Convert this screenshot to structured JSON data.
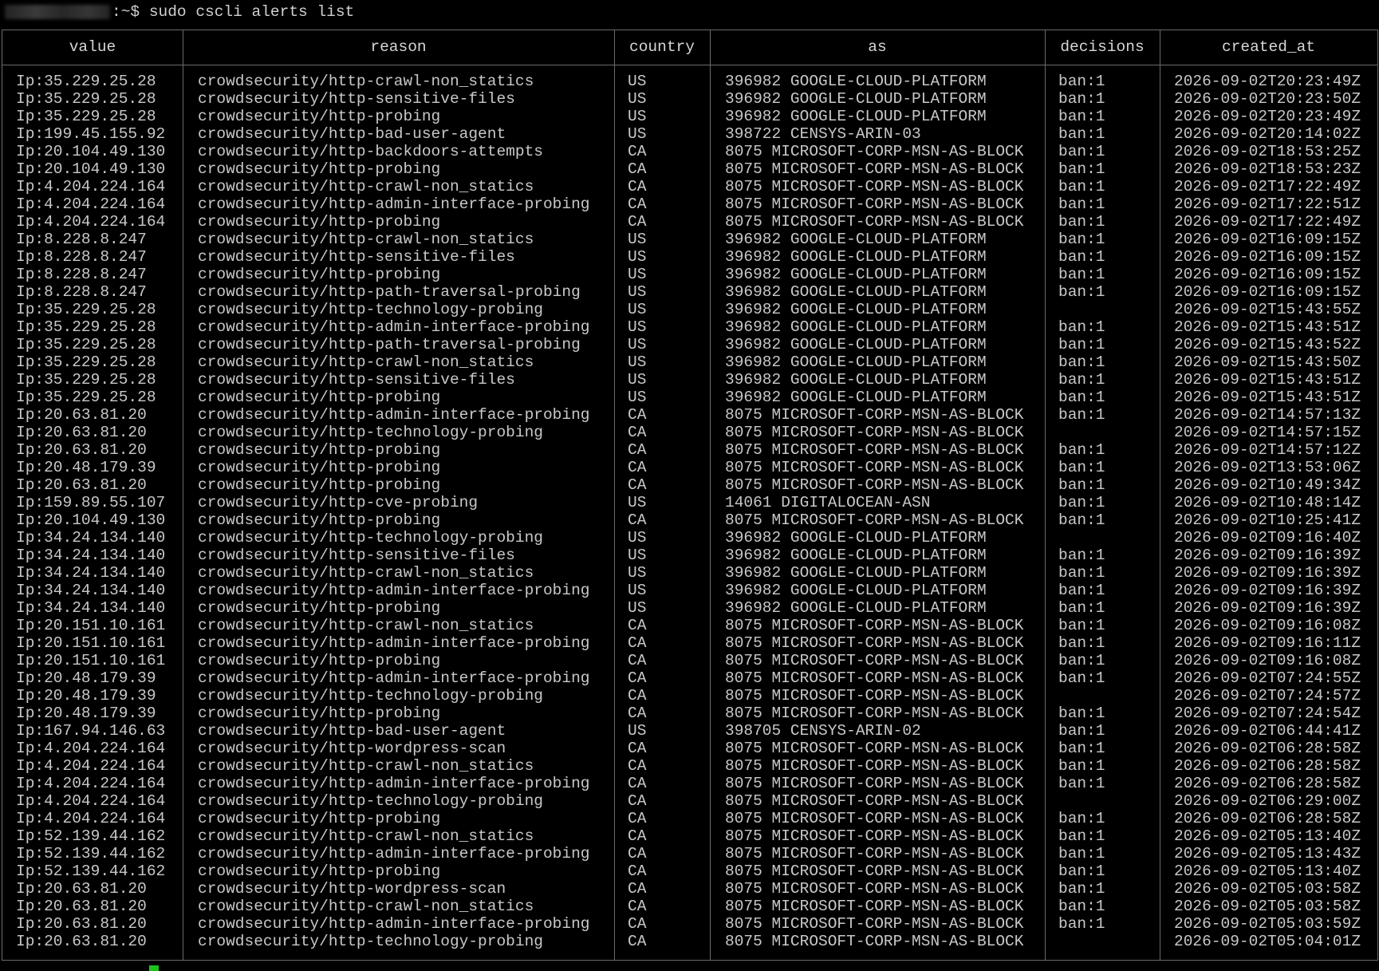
{
  "terminal": {
    "prompt_user": "",
    "prompt_suffix": ":~$ ",
    "command": "sudo cscli alerts list"
  },
  "table": {
    "headers": [
      "value",
      "reason",
      "country",
      "as",
      "decisions",
      "created_at"
    ],
    "rows": [
      [
        "Ip:35.229.25.28",
        "crowdsecurity/http-crawl-non_statics",
        "US",
        "396982 GOOGLE-CLOUD-PLATFORM",
        "ban:1",
        "2026-09-02T20:23:49Z"
      ],
      [
        "Ip:35.229.25.28",
        "crowdsecurity/http-sensitive-files",
        "US",
        "396982 GOOGLE-CLOUD-PLATFORM",
        "ban:1",
        "2026-09-02T20:23:50Z"
      ],
      [
        "Ip:35.229.25.28",
        "crowdsecurity/http-probing",
        "US",
        "396982 GOOGLE-CLOUD-PLATFORM",
        "ban:1",
        "2026-09-02T20:23:49Z"
      ],
      [
        "Ip:199.45.155.92",
        "crowdsecurity/http-bad-user-agent",
        "US",
        "398722 CENSYS-ARIN-03",
        "ban:1",
        "2026-09-02T20:14:02Z"
      ],
      [
        "Ip:20.104.49.130",
        "crowdsecurity/http-backdoors-attempts",
        "CA",
        "8075 MICROSOFT-CORP-MSN-AS-BLOCK",
        "ban:1",
        "2026-09-02T18:53:25Z"
      ],
      [
        "Ip:20.104.49.130",
        "crowdsecurity/http-probing",
        "CA",
        "8075 MICROSOFT-CORP-MSN-AS-BLOCK",
        "ban:1",
        "2026-09-02T18:53:23Z"
      ],
      [
        "Ip:4.204.224.164",
        "crowdsecurity/http-crawl-non_statics",
        "CA",
        "8075 MICROSOFT-CORP-MSN-AS-BLOCK",
        "ban:1",
        "2026-09-02T17:22:49Z"
      ],
      [
        "Ip:4.204.224.164",
        "crowdsecurity/http-admin-interface-probing",
        "CA",
        "8075 MICROSOFT-CORP-MSN-AS-BLOCK",
        "ban:1",
        "2026-09-02T17:22:51Z"
      ],
      [
        "Ip:4.204.224.164",
        "crowdsecurity/http-probing",
        "CA",
        "8075 MICROSOFT-CORP-MSN-AS-BLOCK",
        "ban:1",
        "2026-09-02T17:22:49Z"
      ],
      [
        "Ip:8.228.8.247",
        "crowdsecurity/http-crawl-non_statics",
        "US",
        "396982 GOOGLE-CLOUD-PLATFORM",
        "ban:1",
        "2026-09-02T16:09:15Z"
      ],
      [
        "Ip:8.228.8.247",
        "crowdsecurity/http-sensitive-files",
        "US",
        "396982 GOOGLE-CLOUD-PLATFORM",
        "ban:1",
        "2026-09-02T16:09:15Z"
      ],
      [
        "Ip:8.228.8.247",
        "crowdsecurity/http-probing",
        "US",
        "396982 GOOGLE-CLOUD-PLATFORM",
        "ban:1",
        "2026-09-02T16:09:15Z"
      ],
      [
        "Ip:8.228.8.247",
        "crowdsecurity/http-path-traversal-probing",
        "US",
        "396982 GOOGLE-CLOUD-PLATFORM",
        "ban:1",
        "2026-09-02T16:09:15Z"
      ],
      [
        "Ip:35.229.25.28",
        "crowdsecurity/http-technology-probing",
        "US",
        "396982 GOOGLE-CLOUD-PLATFORM",
        "",
        "2026-09-02T15:43:55Z"
      ],
      [
        "Ip:35.229.25.28",
        "crowdsecurity/http-admin-interface-probing",
        "US",
        "396982 GOOGLE-CLOUD-PLATFORM",
        "ban:1",
        "2026-09-02T15:43:51Z"
      ],
      [
        "Ip:35.229.25.28",
        "crowdsecurity/http-path-traversal-probing",
        "US",
        "396982 GOOGLE-CLOUD-PLATFORM",
        "ban:1",
        "2026-09-02T15:43:52Z"
      ],
      [
        "Ip:35.229.25.28",
        "crowdsecurity/http-crawl-non_statics",
        "US",
        "396982 GOOGLE-CLOUD-PLATFORM",
        "ban:1",
        "2026-09-02T15:43:50Z"
      ],
      [
        "Ip:35.229.25.28",
        "crowdsecurity/http-sensitive-files",
        "US",
        "396982 GOOGLE-CLOUD-PLATFORM",
        "ban:1",
        "2026-09-02T15:43:51Z"
      ],
      [
        "Ip:35.229.25.28",
        "crowdsecurity/http-probing",
        "US",
        "396982 GOOGLE-CLOUD-PLATFORM",
        "ban:1",
        "2026-09-02T15:43:51Z"
      ],
      [
        "Ip:20.63.81.20",
        "crowdsecurity/http-admin-interface-probing",
        "CA",
        "8075 MICROSOFT-CORP-MSN-AS-BLOCK",
        "ban:1",
        "2026-09-02T14:57:13Z"
      ],
      [
        "Ip:20.63.81.20",
        "crowdsecurity/http-technology-probing",
        "CA",
        "8075 MICROSOFT-CORP-MSN-AS-BLOCK",
        "",
        "2026-09-02T14:57:15Z"
      ],
      [
        "Ip:20.63.81.20",
        "crowdsecurity/http-probing",
        "CA",
        "8075 MICROSOFT-CORP-MSN-AS-BLOCK",
        "ban:1",
        "2026-09-02T14:57:12Z"
      ],
      [
        "Ip:20.48.179.39",
        "crowdsecurity/http-probing",
        "CA",
        "8075 MICROSOFT-CORP-MSN-AS-BLOCK",
        "ban:1",
        "2026-09-02T13:53:06Z"
      ],
      [
        "Ip:20.63.81.20",
        "crowdsecurity/http-probing",
        "CA",
        "8075 MICROSOFT-CORP-MSN-AS-BLOCK",
        "ban:1",
        "2026-09-02T10:49:34Z"
      ],
      [
        "Ip:159.89.55.107",
        "crowdsecurity/http-cve-probing",
        "US",
        "14061 DIGITALOCEAN-ASN",
        "ban:1",
        "2026-09-02T10:48:14Z"
      ],
      [
        "Ip:20.104.49.130",
        "crowdsecurity/http-probing",
        "CA",
        "8075 MICROSOFT-CORP-MSN-AS-BLOCK",
        "ban:1",
        "2026-09-02T10:25:41Z"
      ],
      [
        "Ip:34.24.134.140",
        "crowdsecurity/http-technology-probing",
        "US",
        "396982 GOOGLE-CLOUD-PLATFORM",
        "",
        "2026-09-02T09:16:40Z"
      ],
      [
        "Ip:34.24.134.140",
        "crowdsecurity/http-sensitive-files",
        "US",
        "396982 GOOGLE-CLOUD-PLATFORM",
        "ban:1",
        "2026-09-02T09:16:39Z"
      ],
      [
        "Ip:34.24.134.140",
        "crowdsecurity/http-crawl-non_statics",
        "US",
        "396982 GOOGLE-CLOUD-PLATFORM",
        "ban:1",
        "2026-09-02T09:16:39Z"
      ],
      [
        "Ip:34.24.134.140",
        "crowdsecurity/http-admin-interface-probing",
        "US",
        "396982 GOOGLE-CLOUD-PLATFORM",
        "ban:1",
        "2026-09-02T09:16:39Z"
      ],
      [
        "Ip:34.24.134.140",
        "crowdsecurity/http-probing",
        "US",
        "396982 GOOGLE-CLOUD-PLATFORM",
        "ban:1",
        "2026-09-02T09:16:39Z"
      ],
      [
        "Ip:20.151.10.161",
        "crowdsecurity/http-crawl-non_statics",
        "CA",
        "8075 MICROSOFT-CORP-MSN-AS-BLOCK",
        "ban:1",
        "2026-09-02T09:16:08Z"
      ],
      [
        "Ip:20.151.10.161",
        "crowdsecurity/http-admin-interface-probing",
        "CA",
        "8075 MICROSOFT-CORP-MSN-AS-BLOCK",
        "ban:1",
        "2026-09-02T09:16:11Z"
      ],
      [
        "Ip:20.151.10.161",
        "crowdsecurity/http-probing",
        "CA",
        "8075 MICROSOFT-CORP-MSN-AS-BLOCK",
        "ban:1",
        "2026-09-02T09:16:08Z"
      ],
      [
        "Ip:20.48.179.39",
        "crowdsecurity/http-admin-interface-probing",
        "CA",
        "8075 MICROSOFT-CORP-MSN-AS-BLOCK",
        "ban:1",
        "2026-09-02T07:24:55Z"
      ],
      [
        "Ip:20.48.179.39",
        "crowdsecurity/http-technology-probing",
        "CA",
        "8075 MICROSOFT-CORP-MSN-AS-BLOCK",
        "",
        "2026-09-02T07:24:57Z"
      ],
      [
        "Ip:20.48.179.39",
        "crowdsecurity/http-probing",
        "CA",
        "8075 MICROSOFT-CORP-MSN-AS-BLOCK",
        "ban:1",
        "2026-09-02T07:24:54Z"
      ],
      [
        "Ip:167.94.146.63",
        "crowdsecurity/http-bad-user-agent",
        "US",
        "398705 CENSYS-ARIN-02",
        "ban:1",
        "2026-09-02T06:44:41Z"
      ],
      [
        "Ip:4.204.224.164",
        "crowdsecurity/http-wordpress-scan",
        "CA",
        "8075 MICROSOFT-CORP-MSN-AS-BLOCK",
        "ban:1",
        "2026-09-02T06:28:58Z"
      ],
      [
        "Ip:4.204.224.164",
        "crowdsecurity/http-crawl-non_statics",
        "CA",
        "8075 MICROSOFT-CORP-MSN-AS-BLOCK",
        "ban:1",
        "2026-09-02T06:28:58Z"
      ],
      [
        "Ip:4.204.224.164",
        "crowdsecurity/http-admin-interface-probing",
        "CA",
        "8075 MICROSOFT-CORP-MSN-AS-BLOCK",
        "ban:1",
        "2026-09-02T06:28:58Z"
      ],
      [
        "Ip:4.204.224.164",
        "crowdsecurity/http-technology-probing",
        "CA",
        "8075 MICROSOFT-CORP-MSN-AS-BLOCK",
        "",
        "2026-09-02T06:29:00Z"
      ],
      [
        "Ip:4.204.224.164",
        "crowdsecurity/http-probing",
        "CA",
        "8075 MICROSOFT-CORP-MSN-AS-BLOCK",
        "ban:1",
        "2026-09-02T06:28:58Z"
      ],
      [
        "Ip:52.139.44.162",
        "crowdsecurity/http-crawl-non_statics",
        "CA",
        "8075 MICROSOFT-CORP-MSN-AS-BLOCK",
        "ban:1",
        "2026-09-02T05:13:40Z"
      ],
      [
        "Ip:52.139.44.162",
        "crowdsecurity/http-admin-interface-probing",
        "CA",
        "8075 MICROSOFT-CORP-MSN-AS-BLOCK",
        "ban:1",
        "2026-09-02T05:13:43Z"
      ],
      [
        "Ip:52.139.44.162",
        "crowdsecurity/http-probing",
        "CA",
        "8075 MICROSOFT-CORP-MSN-AS-BLOCK",
        "ban:1",
        "2026-09-02T05:13:40Z"
      ],
      [
        "Ip:20.63.81.20",
        "crowdsecurity/http-wordpress-scan",
        "CA",
        "8075 MICROSOFT-CORP-MSN-AS-BLOCK",
        "ban:1",
        "2026-09-02T05:03:58Z"
      ],
      [
        "Ip:20.63.81.20",
        "crowdsecurity/http-crawl-non_statics",
        "CA",
        "8075 MICROSOFT-CORP-MSN-AS-BLOCK",
        "ban:1",
        "2026-09-02T05:03:58Z"
      ],
      [
        "Ip:20.63.81.20",
        "crowdsecurity/http-admin-interface-probing",
        "CA",
        "8075 MICROSOFT-CORP-MSN-AS-BLOCK",
        "ban:1",
        "2026-09-02T05:03:59Z"
      ],
      [
        "Ip:20.63.81.20",
        "crowdsecurity/http-technology-probing",
        "CA",
        "8075 MICROSOFT-CORP-MSN-AS-BLOCK",
        "",
        "2026-09-02T05:04:01Z"
      ]
    ]
  },
  "colors": {
    "background": "#000000",
    "text": "#c8c8c8",
    "border": "#6a6a6a",
    "cursor": "#20c020"
  }
}
